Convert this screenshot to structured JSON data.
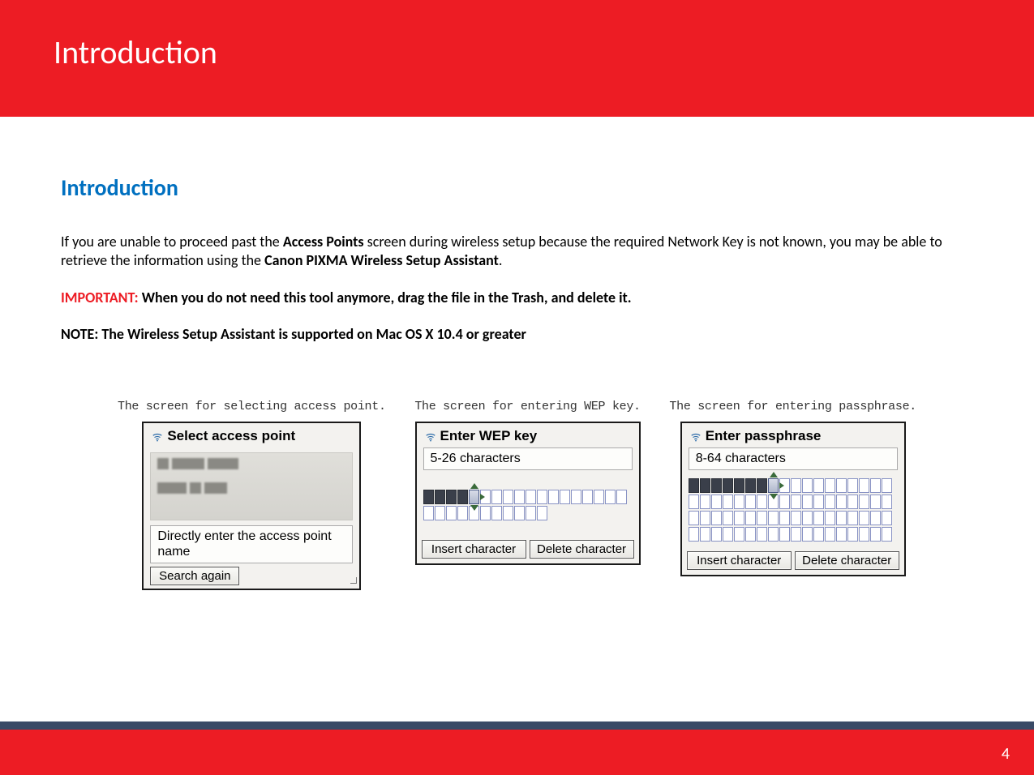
{
  "header": {
    "title": "Introduction"
  },
  "subtitle": "Introduction",
  "paragraph": {
    "pre": "If you are unable to proceed past the ",
    "bold1": "Access Points",
    "mid": " screen during wireless setup because the required Network Key is not known, you may be able to retrieve the information using the ",
    "bold2": "Canon PIXMA Wireless Setup Assistant",
    "end": "."
  },
  "important": {
    "label": "IMPORTANT: ",
    "text": "When you do not need this tool anymore, drag the file in the Trash, and delete it."
  },
  "note": "NOTE:  The Wireless Setup Assistant is supported on Mac OS X 10.4 or greater",
  "screens": {
    "access_point": {
      "caption": "The screen for selecting access point.",
      "title": "Select access point",
      "option": "Directly enter the access point name",
      "button": "Search again"
    },
    "wep": {
      "caption": "The screen for entering WEP key.",
      "title": "Enter WEP key",
      "sub": "5-26 characters",
      "insert": "Insert character",
      "delete": "Delete character"
    },
    "passphrase": {
      "caption": "The screen for entering passphrase.",
      "title": "Enter passphrase",
      "sub": "8-64 characters",
      "insert": "Insert character",
      "delete": "Delete character"
    }
  },
  "footer": {
    "page": "4"
  }
}
